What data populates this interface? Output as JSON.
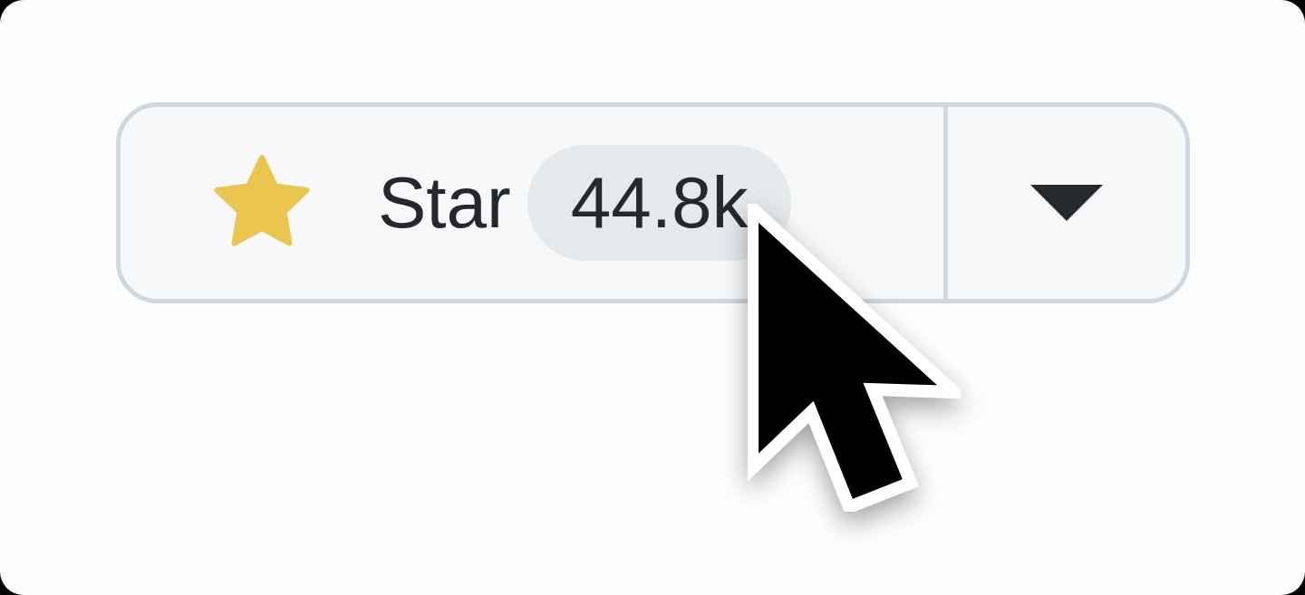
{
  "star_button": {
    "label": "Star",
    "count": "44.8k",
    "starred": true
  }
}
